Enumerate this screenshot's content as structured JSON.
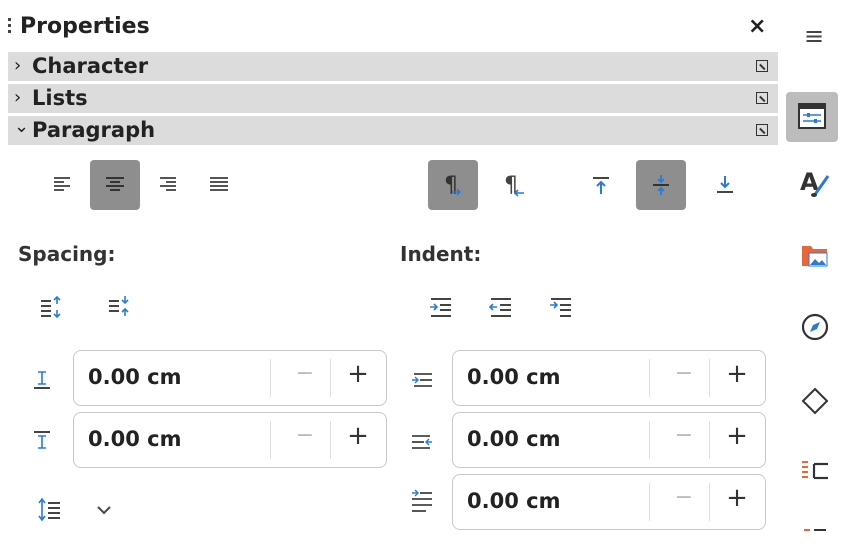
{
  "panel": {
    "title": "Properties",
    "close_glyph": "×"
  },
  "sections": {
    "character": {
      "label": "Character",
      "state": "collapsed",
      "chevron": "›"
    },
    "lists": {
      "label": "Lists",
      "state": "collapsed",
      "chevron": "›"
    },
    "paragraph": {
      "label": "Paragraph",
      "state": "expanded",
      "chevron": "⌄"
    }
  },
  "paragraph": {
    "alignment": {
      "options": [
        "align-left",
        "align-center",
        "align-right",
        "justified"
      ],
      "selected": "align-center"
    },
    "direction": {
      "options": [
        "left-to-right",
        "right-to-left"
      ],
      "selected": "left-to-right"
    },
    "vertical_alignment": {
      "options": [
        "align-top",
        "align-middle",
        "align-bottom"
      ],
      "selected": "align-middle"
    },
    "spacing": {
      "label": "Spacing:",
      "above": {
        "value": "0.00 cm"
      },
      "below": {
        "value": "0.00 cm"
      },
      "line_spacing_icon": "line-spacing-icon"
    },
    "indent": {
      "label": "Indent:",
      "before_text": {
        "value": "0.00 cm"
      },
      "after_text": {
        "value": "0.00 cm"
      },
      "first_line": {
        "value": "0.00 cm"
      }
    },
    "stepper": {
      "minus": "−",
      "plus": "+"
    }
  },
  "sidebar": {
    "menu_glyph": "≡",
    "items": [
      "properties",
      "styles",
      "gallery",
      "navigator",
      "shapes",
      "page"
    ],
    "active": "properties"
  },
  "colors": {
    "accent": "#2a7bd4",
    "section_header": "#dcdcdc",
    "active_button": "#8e8e8e",
    "orange": "#e8673a"
  }
}
